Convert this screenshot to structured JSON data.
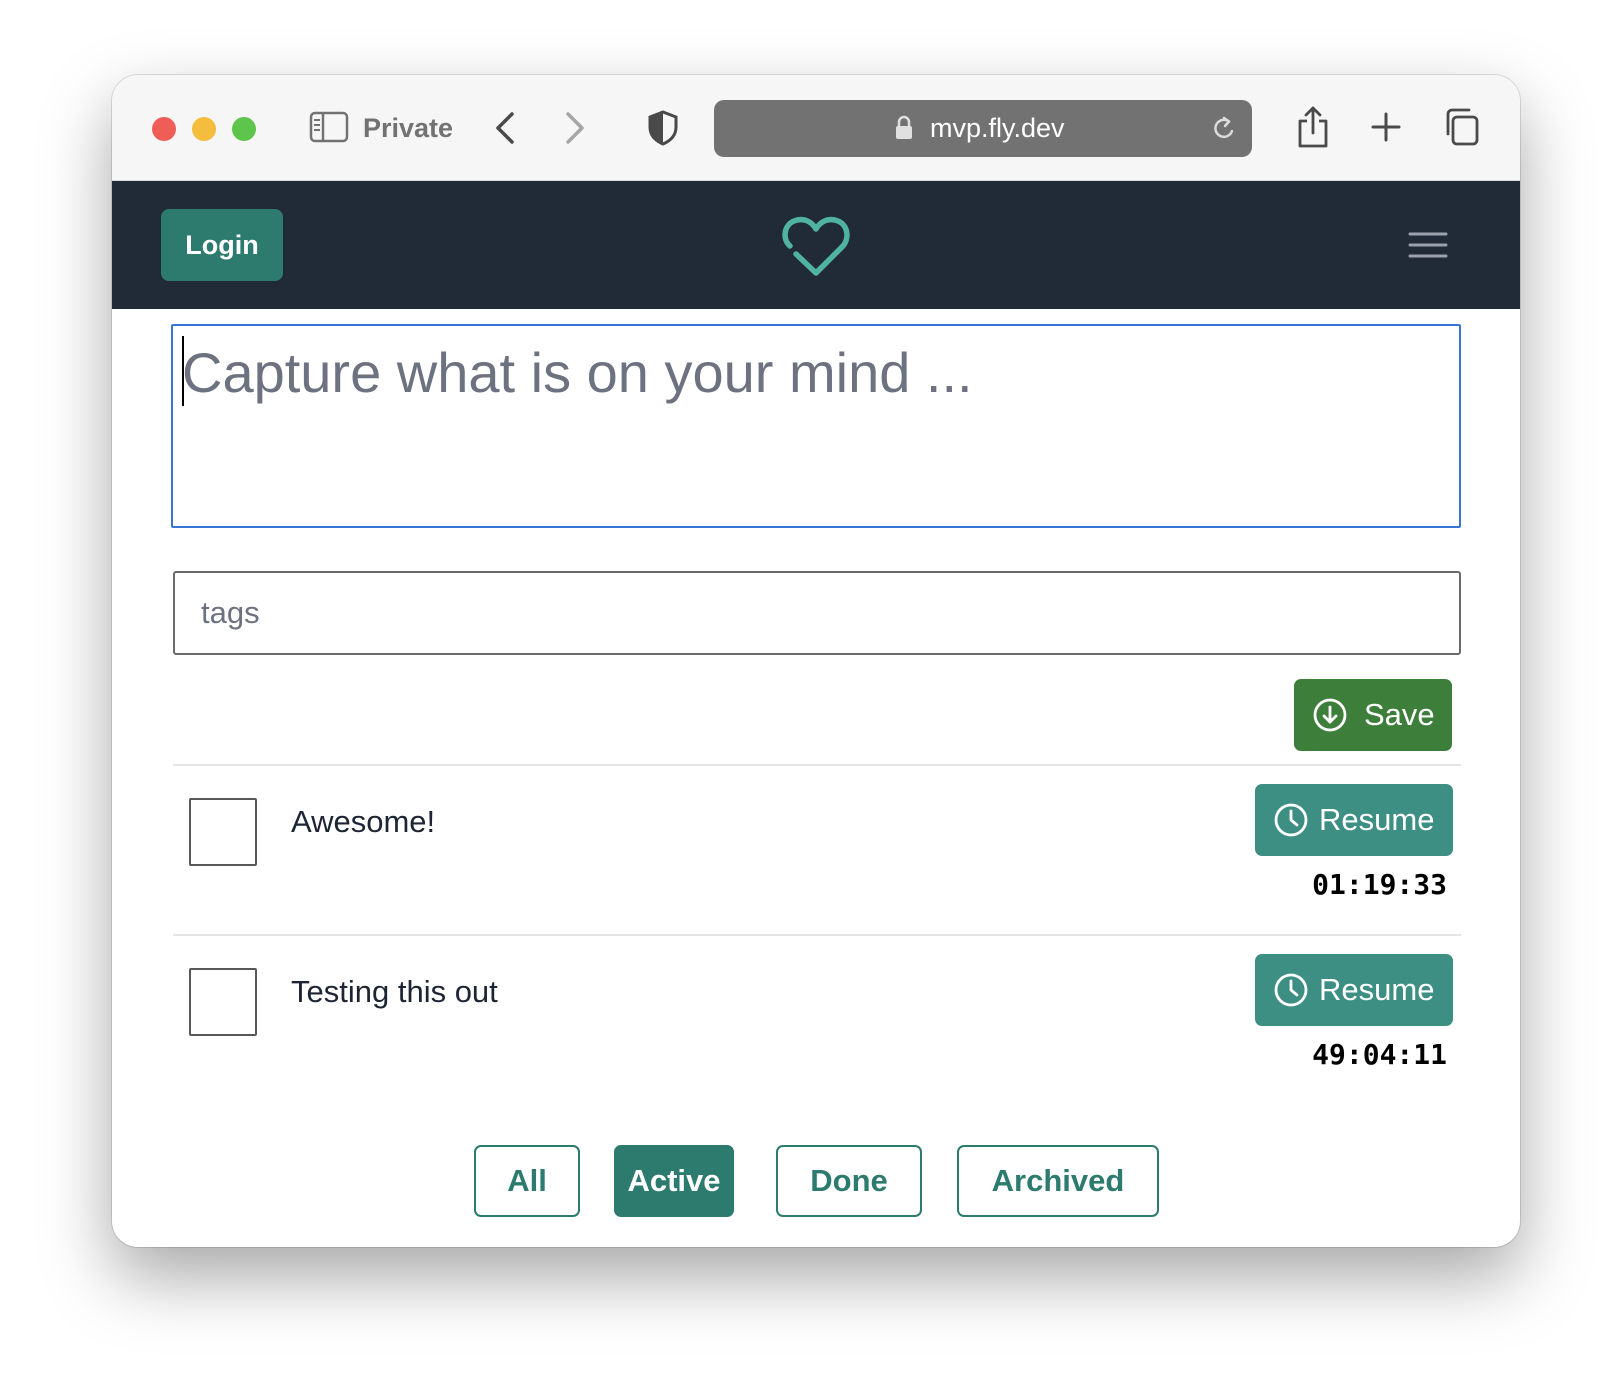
{
  "browser": {
    "private_label": "Private",
    "url": "mvp.fly.dev"
  },
  "navbar": {
    "login_label": "Login",
    "logo_icon": "heart-check-icon",
    "menu_icon": "hamburger-menu-icon",
    "accent_color": "#2d7b6e",
    "background_color": "#212a37"
  },
  "form": {
    "mind_placeholder": "Capture what is on your mind ...",
    "tags_placeholder": "tags",
    "save_label": "Save",
    "save_color": "#3e7e3b"
  },
  "tasks": [
    {
      "text": "Awesome!",
      "resume_label": "Resume",
      "timer": "01:19:33",
      "checked": false
    },
    {
      "text": "Testing this out",
      "resume_label": "Resume",
      "timer": "49:04:11",
      "checked": false
    }
  ],
  "filters": {
    "all": "All",
    "active": "Active",
    "done": "Done",
    "archived": "Archived",
    "selected": "Active"
  }
}
